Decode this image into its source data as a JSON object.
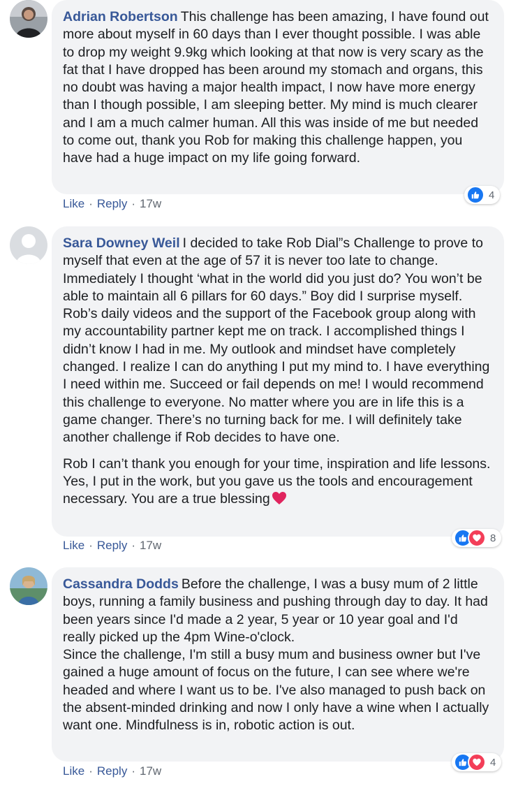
{
  "comments": [
    {
      "author": "Adrian Robertson",
      "paragraphs": [
        "This challenge has been amazing, I have found out more about myself in 60 days than I ever thought possible. I was able to drop my weight 9.9kg which looking at that now is very scary as the fat that I have dropped has been around my stomach and organs, this no doubt was having a major health impact, I now have more energy than I though possible, I am sleeping better. My mind is much clearer and I am a much calmer human. All this was inside of me but needed to come out, thank you Rob for making this challenge happen, you have had a huge impact on my life going forward."
      ],
      "reaction_count": "4",
      "like_label": "Like",
      "reply_label": "Reply",
      "time": "17w"
    },
    {
      "author": "Sara Downey Weil",
      "paragraphs": [
        "I decided to take Rob Dial”s Challenge to prove to myself that even at the age of 57 it is never too late to change. Immediately I thought ‘what in the world did you just do? You won’t be able to maintain all 6 pillars for 60 days.” Boy did I surprise myself. Rob’s daily videos and the support of the Facebook group along with my accountability partner kept me on track. I accomplished things I didn’t know I had in me. My outlook and mindset have completely changed. I realize I can do anything I put my mind to. I have everything I need within me. Succeed or fail depends on me! I would recommend this challenge to everyone. No matter where you are in life this is a game changer. There’s no turning back for me. I will definitely take another challenge if Rob decides to have one.",
        "Rob I can’t thank you enough for your time, inspiration and life lessons. Yes, I put in the work, but you gave us the tools and encouragement necessary. You are a true blessing"
      ],
      "reaction_count": "8",
      "like_label": "Like",
      "reply_label": "Reply",
      "time": "17w"
    },
    {
      "author": "Cassandra Dodds",
      "paragraphs": [
        "Before the challenge, I was a busy mum of 2 little boys, running a family business and pushing through day to day. It had been years since I'd made a 2 year, 5 year or 10 year goal and I'd really picked up the 4pm Wine-o'clock.\nSince the challenge, I'm still a busy mum and business owner but I've gained a huge amount of focus on the future, I can see where we're headed and where I want us to be. I've also managed to push back on the absent-minded drinking and now I only have a wine when I actually want one. Mindfulness is in, robotic action is out."
      ],
      "reaction_count": "4",
      "like_label": "Like",
      "reply_label": "Reply",
      "time": "17w"
    }
  ],
  "icons": {
    "like_reaction": "thumbs-up-icon",
    "love_reaction": "heart-icon",
    "inline_heart": "red-heart-emoji-icon",
    "default_avatar": "default-avatar-icon"
  },
  "colors": {
    "author_link": "#385898",
    "bubble_bg": "#f2f3f5",
    "like_blue": "#1877f2",
    "love_red": "#f33e58",
    "meta_gray": "#606770"
  }
}
